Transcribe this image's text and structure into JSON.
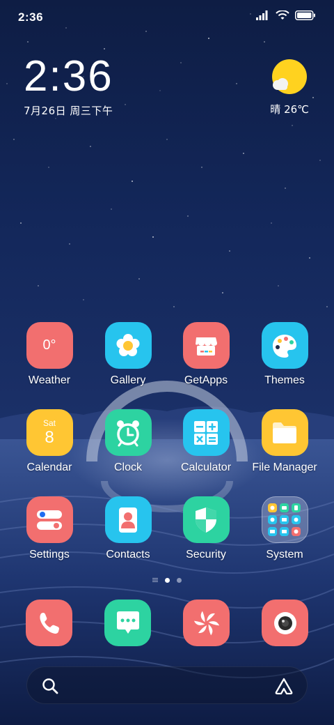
{
  "status_bar": {
    "time": "2:36"
  },
  "clock_widget": {
    "time": "2:36",
    "date": "7月26日 周三下午"
  },
  "weather_widget": {
    "condition_temp": "晴 26℃"
  },
  "apps": {
    "weather": {
      "label": "Weather",
      "icon_text": "0°"
    },
    "gallery": {
      "label": "Gallery"
    },
    "getapps": {
      "label": "GetApps"
    },
    "themes": {
      "label": "Themes"
    },
    "calendar": {
      "label": "Calendar",
      "day_name": "Sat",
      "day_num": "8"
    },
    "clock": {
      "label": "Clock"
    },
    "calculator": {
      "label": "Calculator"
    },
    "file_manager": {
      "label": "File Manager"
    },
    "settings": {
      "label": "Settings"
    },
    "contacts": {
      "label": "Contacts"
    },
    "security": {
      "label": "Security"
    },
    "system": {
      "label": "System"
    }
  },
  "colors": {
    "coral": "#f26f6f",
    "sky": "#27c4ee",
    "yellow": "#ffc633",
    "green": "#2dd3a1",
    "sun": "#ffd21f"
  },
  "icons": {
    "dock": [
      "phone-icon",
      "messaging-icon",
      "browser-icon",
      "camera-icon"
    ],
    "search_bar": [
      "search-icon",
      "assistant-icon"
    ]
  }
}
